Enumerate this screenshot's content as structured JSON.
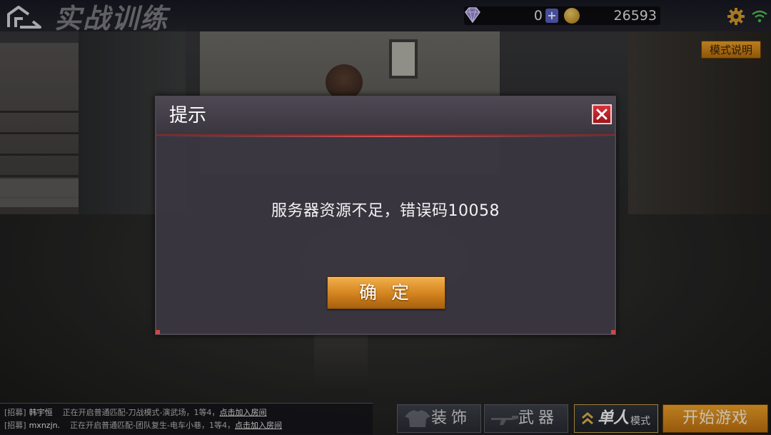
{
  "header": {
    "title": "实战训练",
    "diamonds": "0",
    "coins": "26593",
    "mode_help_label": "模式说明"
  },
  "dialog": {
    "title": "提示",
    "message": "服务器资源不足，错误码10058",
    "confirm_label": "确 定"
  },
  "chat": [
    {
      "tag": "[招募]",
      "user": "韩宇恒",
      "message": "正在开启普通匹配-刀战模式-演武场，1等4，",
      "link": "点击加入房间"
    },
    {
      "tag": "[招募]",
      "user": "mxnzjn.",
      "message": "正在开启普通匹配-团队复生-电车小巷，1等4，",
      "link": "点击加入房间"
    }
  ],
  "bottom_bar": {
    "equip_label": "装饰",
    "weapon_label": "武器",
    "mode_main": "单人",
    "mode_sub": "模式",
    "start_label": "开始游戏"
  },
  "colors": {
    "accent_orange": "#d2821e",
    "close_red": "#c92a31",
    "plus_blue": "#5a63c6"
  },
  "icons": [
    "home-icon",
    "diamond-icon",
    "plus-icon",
    "coin-icon",
    "gear-icon",
    "wifi-icon",
    "close-icon",
    "shirt-icon",
    "rifle-icon",
    "chevron-up-icon"
  ]
}
